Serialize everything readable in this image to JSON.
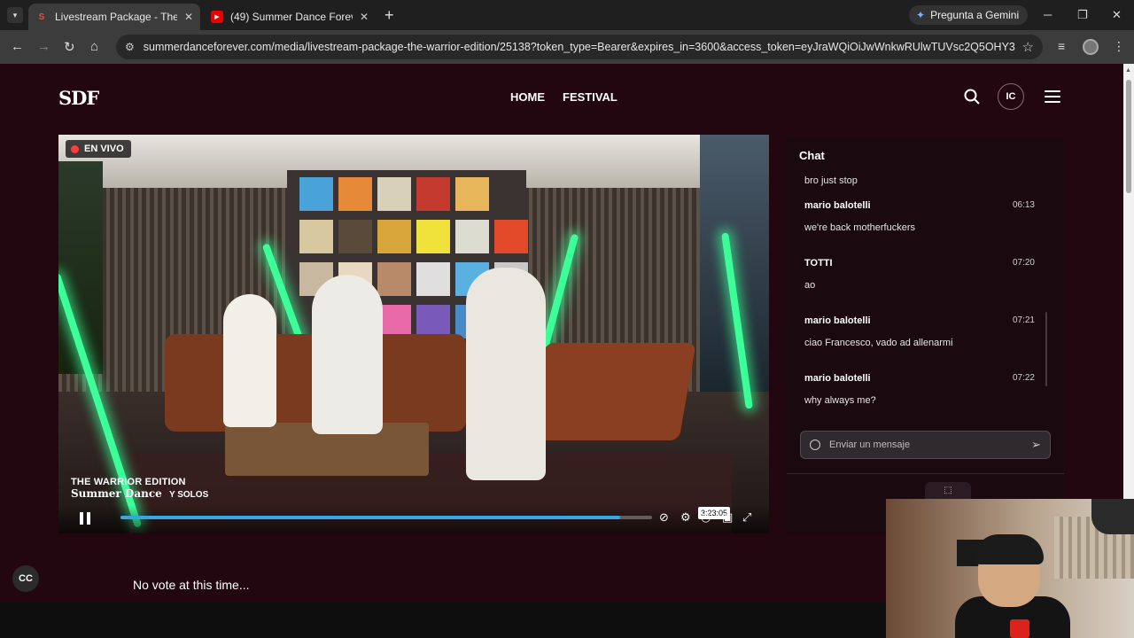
{
  "browser": {
    "tabs": [
      {
        "title": "Livestream Package - The Warri",
        "active": true,
        "favicon": "S"
      },
      {
        "title": "(49) Summer Dance Forever - Y",
        "active": false,
        "favicon": "▶"
      }
    ],
    "gemini_label": "Pregunta a Gemini",
    "url": "summerdanceforever.com/media/livestream-package-the-warrior-edition/25138?token_type=Bearer&expires_in=3600&access_token=eyJraWQiOiJwWnkwRUlwTUVsc2Q5OHY3ejk4eVhBckl..."
  },
  "site": {
    "logo": "SDF",
    "nav": [
      "HOME",
      "FESTIVAL"
    ],
    "avatar_initials": "IC"
  },
  "video": {
    "live_label": "EN VIVO",
    "overlay_title": "THE WARRIOR EDITION",
    "overlay_logo": "Summer Dance",
    "overlay_sub": "Y SOLOS",
    "time_tooltip": "3:23:05",
    "progress": 0.94,
    "accent": "#35a7e8"
  },
  "chat": {
    "title": "Chat",
    "first_text": "bro just stop",
    "messages": [
      {
        "user": "mario balotelli",
        "time": "06:13",
        "text": "we're back motherfuckers"
      },
      {
        "user": "TOTTI",
        "time": "07:20",
        "text": "ao"
      },
      {
        "user": "mario balotelli",
        "time": "07:21",
        "text": "ciao Francesco, vado ad allenarmi"
      },
      {
        "user": "mario balotelli",
        "time": "07:22",
        "text": "why always me?"
      }
    ],
    "input_placeholder": "Enviar un mensaje"
  },
  "bottom": {
    "cc_label": "CC",
    "vote_text": "No vote at this time..."
  }
}
